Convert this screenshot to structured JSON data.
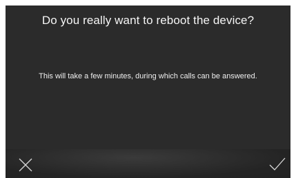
{
  "dialog": {
    "title": "Do you really want to reboot the device?",
    "message": "This will take a few minutes, during which calls can be answered."
  },
  "actions": {
    "cancel_icon": "close-icon",
    "confirm_icon": "checkmark-icon"
  },
  "colors": {
    "background": "#2b2b2b",
    "text": "#f2f2f2",
    "icon": "#d8d8d8"
  }
}
